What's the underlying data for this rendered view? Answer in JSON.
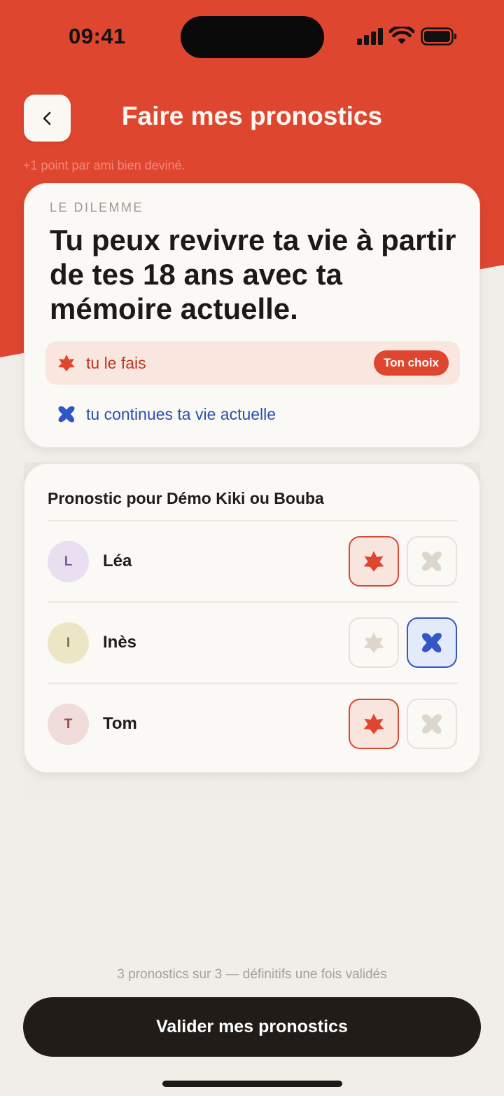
{
  "status": {
    "time": "09:41"
  },
  "header": {
    "title": "Faire mes pronostics",
    "subtitle": "+1 point par ami bien deviné."
  },
  "dilemma": {
    "eyebrow": "LE DILEMME",
    "question": "Tu peux revivre ta vie à partir de tes 18 ans avec ta mémoire actuelle.",
    "option_a": {
      "label": "tu le fais",
      "icon": "star-icon",
      "color": "#df4630"
    },
    "option_b": {
      "label": "tu continues ta vie actuelle",
      "icon": "blob-icon",
      "color": "#2a4fb3"
    },
    "choice_badge": "Ton choix"
  },
  "predictions": {
    "title": "Pronostic pour Démo Kiki ou Bouba",
    "rows": [
      {
        "initial": "L",
        "name": "Léa",
        "pick": "star",
        "avatar_bg": "#e9dff0",
        "avatar_fg": "#7a5a95"
      },
      {
        "initial": "I",
        "name": "Inès",
        "pick": "blob",
        "avatar_bg": "#ede6c6",
        "avatar_fg": "#7d7140"
      },
      {
        "initial": "T",
        "name": "Tom",
        "pick": "star",
        "avatar_bg": "#f0dcda",
        "avatar_fg": "#944a42"
      }
    ]
  },
  "footer": {
    "note": "3 pronostics sur 3 — définitifs une fois validés",
    "validate_label": "Valider mes pronostics"
  },
  "colors": {
    "accent": "#df4630",
    "blue": "#3557c6",
    "dark": "#211c18"
  }
}
